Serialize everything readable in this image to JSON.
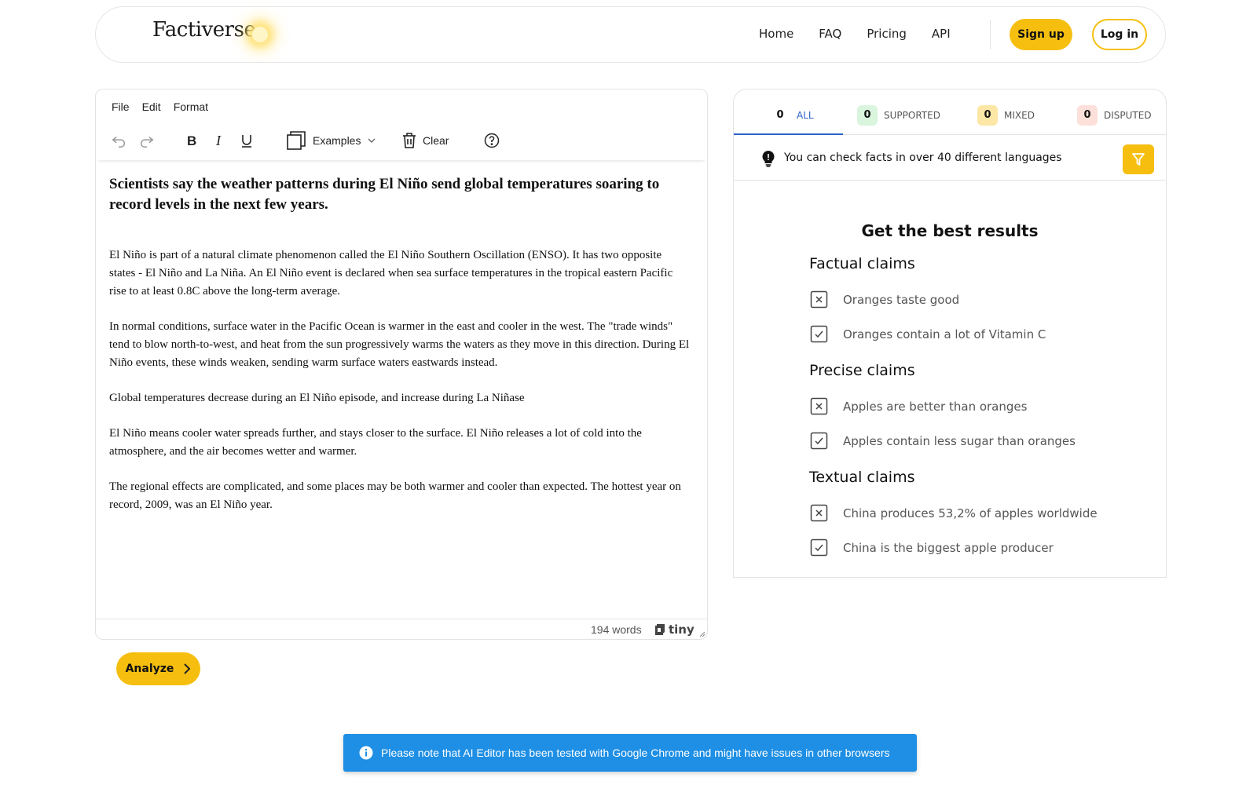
{
  "header": {
    "logo": "Factiverse",
    "nav": [
      "Home",
      "FAQ",
      "Pricing",
      "API"
    ],
    "signup_label": "Sign up",
    "login_label": "Log in"
  },
  "editor": {
    "menu": [
      "File",
      "Edit",
      "Format"
    ],
    "toolbar": {
      "examples_label": "Examples",
      "clear_label": "Clear"
    },
    "heading": "Scientists say the weather patterns during El Niño send global temperatures soaring to record levels in the next few years.",
    "paragraphs": [
      "El Niño is part of a natural climate phenomenon called the El Niño Southern Oscillation (ENSO). It has two opposite states - El Niño and La Niña. An El Niño event is declared when sea surface temperatures in the tropical eastern Pacific rise to at least 0.8C above the long-term average.",
      "In normal conditions, surface water in the Pacific Ocean is warmer in the east and cooler in the west. The \"trade winds\" tend to blow north-to-west, and heat from the sun progressively warms the waters as they move in this direction. During El Niño events, these winds weaken, sending warm surface waters eastwards instead.",
      "Global temperatures decrease during an El Niño episode, and increase during La Niñase",
      "El Niño means cooler water spreads further, and stays closer to the surface. El Niño releases a lot of cold into the atmosphere, and the air becomes wetter and warmer.",
      "The regional effects are complicated, and some places may be both warmer and cooler than expected. The hottest year on record, 2009, was an El Niño year."
    ],
    "word_count": "194 words",
    "brand": "tiny"
  },
  "analyze_label": "Analyze",
  "results": {
    "tabs": [
      {
        "count": "0",
        "label": "ALL",
        "bg": "#ffffff",
        "color": "#2b62c8"
      },
      {
        "count": "0",
        "label": "SUPPORTED",
        "bg": "#d9f5dd",
        "color": "#555555"
      },
      {
        "count": "0",
        "label": "MIXED",
        "bg": "#fde7a6",
        "color": "#555555"
      },
      {
        "count": "0",
        "label": "DISPUTED",
        "bg": "#fde0d9",
        "color": "#555555"
      }
    ],
    "tip": "You can check facts in over 40 different languages",
    "title": "Get the best results",
    "sections": [
      {
        "title": "Factual claims",
        "claims": [
          {
            "text": "Oranges taste good",
            "icon": "x-box-icon"
          },
          {
            "text": "Oranges contain a lot of Vitamin C",
            "icon": "check-box-icon"
          }
        ]
      },
      {
        "title": "Precise claims",
        "claims": [
          {
            "text": "Apples are better than oranges",
            "icon": "x-box-icon"
          },
          {
            "text": "Apples contain less sugar than oranges",
            "icon": "check-box-icon"
          }
        ]
      },
      {
        "title": "Textual claims",
        "claims": [
          {
            "text": "China produces 53,2% of apples worldwide",
            "icon": "x-box-icon"
          },
          {
            "text": "China is the biggest apple producer",
            "icon": "check-box-icon"
          }
        ]
      }
    ]
  },
  "notice": "Please note that AI Editor has been tested with Google Chrome and might have issues in other browsers",
  "colors": {
    "accent": "#f6bf10",
    "notice": "#1e8fe5",
    "tab_active": "#2b62c8"
  }
}
